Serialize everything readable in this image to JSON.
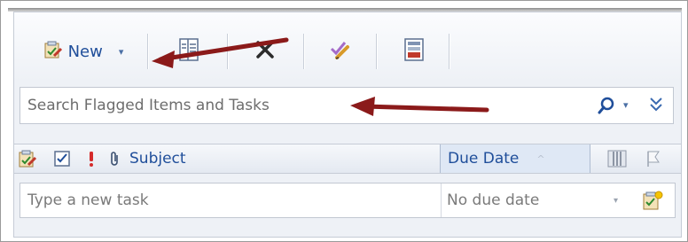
{
  "toolbar": {
    "new_label": "New",
    "new_caret": "▾",
    "buttons": [
      "new-button",
      "open-button",
      "delete-button",
      "mark-complete-button",
      "categorize-button"
    ]
  },
  "search": {
    "placeholder": "Search Flagged Items and Tasks",
    "scope_caret": "▾",
    "expand_icon": "»"
  },
  "header": {
    "subject_label": "Subject",
    "due_label": "Due Date",
    "sort_glyph": "^"
  },
  "new_task": {
    "placeholder": "Type a new task",
    "due_value": "No due date",
    "due_caret": "▾"
  },
  "colors": {
    "link_blue": "#1f4e9a",
    "arrow": "#8b1a1a",
    "panel_bg": "#eef1f6"
  },
  "icons": [
    "new-task-icon",
    "open-card-icon",
    "delete-x-icon",
    "mark-complete-icon",
    "categorize-icon",
    "search-icon",
    "chevron-double-down-icon",
    "task-type-icon",
    "complete-checkbox-icon",
    "importance-icon",
    "attachment-icon",
    "columns-icon",
    "flag-icon",
    "add-task-icon"
  ]
}
